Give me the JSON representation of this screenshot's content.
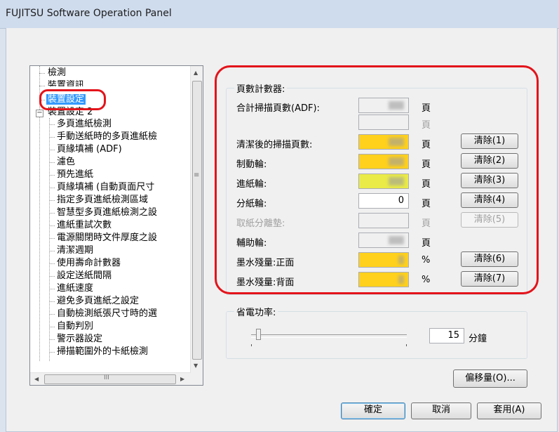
{
  "window": {
    "title": "FUJITSU Software Operation Panel"
  },
  "tree": {
    "items": [
      {
        "label": "檢測"
      },
      {
        "label": "裝置資訊"
      },
      {
        "label": "裝置設定"
      },
      {
        "label": "裝置設定 2"
      },
      {
        "label": "多頁進紙檢測"
      },
      {
        "label": "手動送紙時的多頁進紙檢"
      },
      {
        "label": "頁緣填補 (ADF)"
      },
      {
        "label": "濾色"
      },
      {
        "label": "預先進紙"
      },
      {
        "label": "頁緣填補 (自動頁面尺寸"
      },
      {
        "label": "指定多頁進紙檢測區域"
      },
      {
        "label": "智慧型多頁進紙檢測之設"
      },
      {
        "label": "進紙重試次數"
      },
      {
        "label": "電源關閉時文件厚度之設"
      },
      {
        "label": "清潔週期"
      },
      {
        "label": "使用壽命計數器"
      },
      {
        "label": "設定送紙間隔"
      },
      {
        "label": "進紙速度"
      },
      {
        "label": "避免多頁進紙之設定"
      },
      {
        "label": "自動檢測紙張尺寸時的選"
      },
      {
        "label": "自動判別"
      },
      {
        "label": "警示器設定"
      },
      {
        "label": "掃描範圍外的卡紙檢測"
      }
    ],
    "expander_symbol": "−",
    "scroll_up": "▲",
    "scroll_down": "▼",
    "scroll_left": "◀",
    "scroll_right": "▶",
    "vgrip": "≡",
    "hgrip": "III"
  },
  "counters": {
    "title": "頁數計數器:",
    "rows": [
      {
        "label": "合計掃描頁數(ADF):",
        "unit": "頁",
        "button": ""
      },
      {
        "label": "",
        "unit": "頁",
        "button": ""
      },
      {
        "label": "清潔後的掃描頁數:",
        "unit": "頁",
        "button": "清除(1)"
      },
      {
        "label": "制動輪:",
        "unit": "頁",
        "button": "清除(2)"
      },
      {
        "label": "進紙輪:",
        "unit": "頁",
        "button": "清除(3)"
      },
      {
        "label": "分紙輪:",
        "unit": "頁",
        "button": "清除(4)",
        "value": "0"
      },
      {
        "label": "取紙分離墊:",
        "unit": "頁",
        "button": "清除(5)"
      },
      {
        "label": "輔助輪:",
        "unit": "頁",
        "button": ""
      },
      {
        "label": "墨水殘量:正面",
        "unit": "%",
        "button": "清除(6)"
      },
      {
        "label": "墨水殘量:背面",
        "unit": "%",
        "button": "清除(7)"
      }
    ]
  },
  "power": {
    "title": "省電功率:",
    "value": "15",
    "unit": "分鐘"
  },
  "buttons": {
    "offset": "偏移量(O)...",
    "ok": "確定",
    "cancel": "取消",
    "apply": "套用(A)"
  },
  "colors": {
    "highlight_red": "#e3141b",
    "yellow_field": "#ffd11c",
    "lime_field": "#eaeb47",
    "selection": "#3399ff"
  }
}
